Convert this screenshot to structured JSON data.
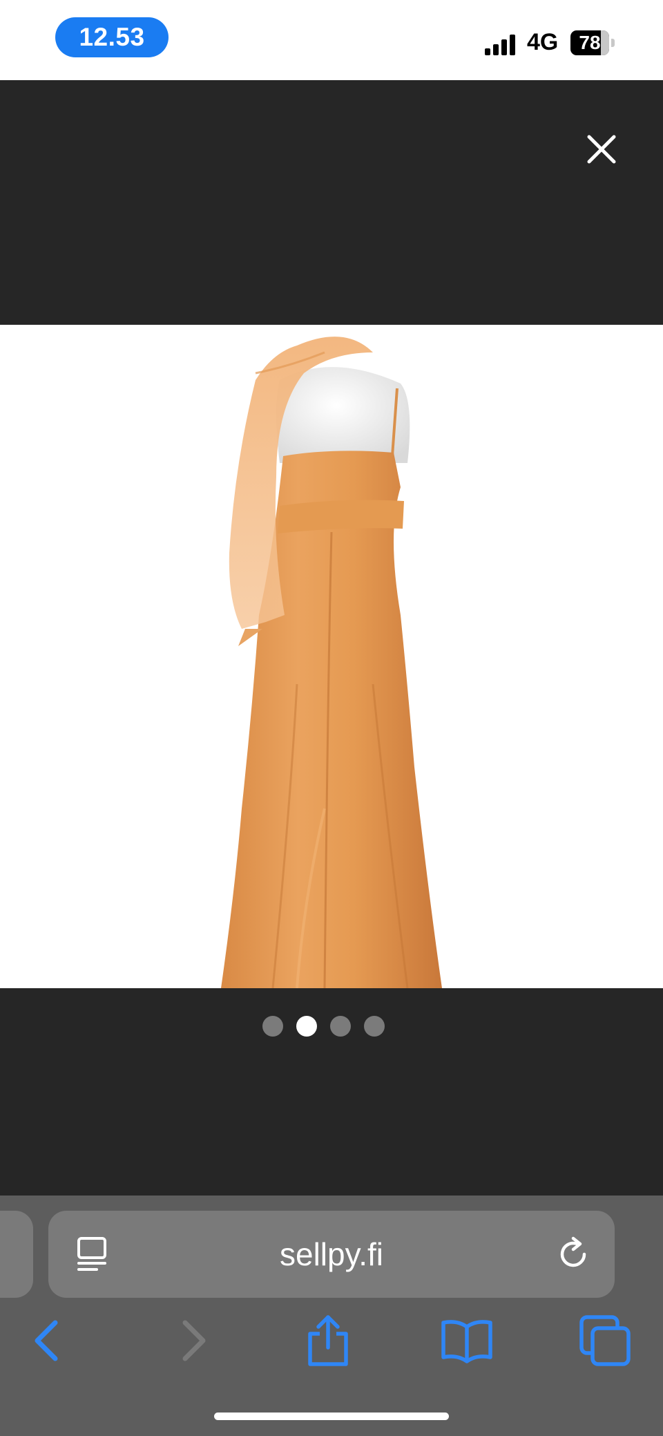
{
  "status_bar": {
    "time": "12.53",
    "network": "4G",
    "battery": "78",
    "battery_level": 0.78
  },
  "viewer": {
    "close_icon": "close-icon",
    "photo": {
      "subject": "orange-gown-back-view",
      "colors": {
        "dress": "#e8a058",
        "dress_shadow": "#c97a38",
        "mannequin": "#f2f2f2"
      }
    },
    "pagination": {
      "count": 4,
      "active_index": 1
    }
  },
  "browser": {
    "url": "sellpy.fi",
    "accent": "#2f86f6",
    "icons": {
      "reader": "page-reader-icon",
      "reload": "reload-icon",
      "back": "back-chevron-icon",
      "forward": "forward-chevron-icon",
      "share": "share-icon",
      "bookmarks": "bookmarks-book-icon",
      "tabs": "tabs-icon"
    }
  }
}
